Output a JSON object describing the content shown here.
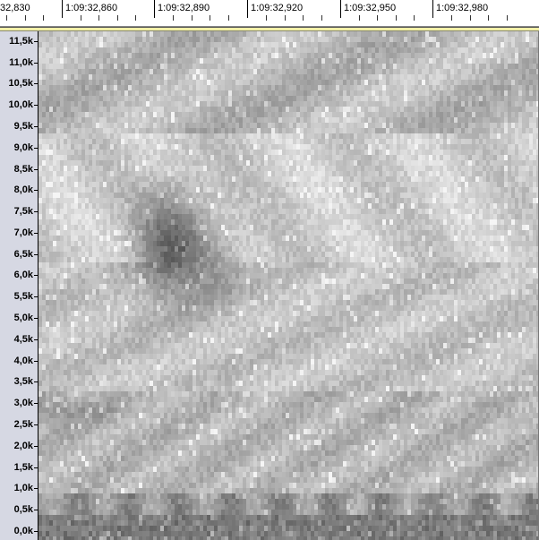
{
  "timeline": {
    "labels": [
      "32,830",
      "1:09:32,860",
      "1:09:32,890",
      "1:09:32,920",
      "1:09:32,950",
      "1:09:32,980"
    ]
  },
  "frequency_ruler": {
    "labels": [
      "11,5k",
      "11,0k",
      "10,5k",
      "10,0k",
      "9,5k",
      "9,0k",
      "8,5k",
      "8,0k",
      "7,5k",
      "7,0k",
      "6,5k",
      "6,0k",
      "5,5k",
      "5,0k",
      "4,5k",
      "4,0k",
      "3,5k",
      "3,0k",
      "2,5k",
      "2,0k",
      "1,5k",
      "1,0k",
      "0,5k",
      "0,0k"
    ],
    "max_khz": 11.6,
    "min_khz": 0.0
  },
  "spectrogram": {
    "colors": {
      "light": "#dcdcdc",
      "mid": "#b4b4b4",
      "dark": "#6e6e6e",
      "highlight": "#f2f2f2"
    }
  }
}
